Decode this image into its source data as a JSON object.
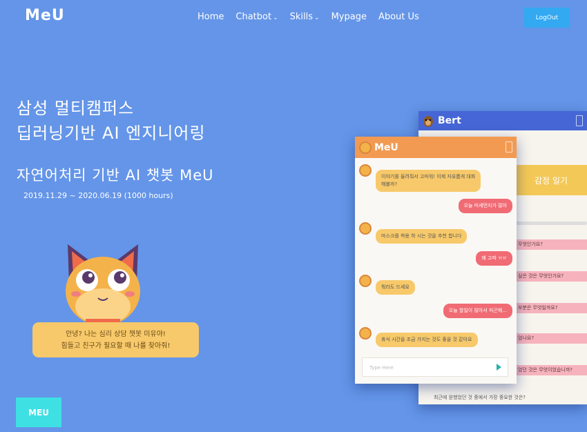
{
  "header": {
    "logo": "MeU",
    "nav": [
      {
        "label": "Home",
        "dropdown": false
      },
      {
        "label": "Chatbot",
        "dropdown": true
      },
      {
        "label": "Skills",
        "dropdown": true
      },
      {
        "label": "Mypage",
        "dropdown": false
      },
      {
        "label": "About Us",
        "dropdown": false
      }
    ],
    "logout_label": "LogOut"
  },
  "hero": {
    "title_line1": "삼성 멀티캠퍼스",
    "title_line2": "딥러닝기반 AI 엔지니어링",
    "subtitle": "자연어처리 기반 AI 챗봇 MeU",
    "date": "2019.11.29 ~ 2020.06.19 (1000 hours)"
  },
  "mascot": {
    "speech_line1": "안녕? 나는 심리 상담 챗봇 미유야!",
    "speech_line2": "힘들고 친구가 필요할 때 나를 찾아줘!"
  },
  "meu_button": "MEU",
  "mockup_back": {
    "title": "Bert",
    "diary_title": "감정 일기",
    "rows": [
      "무엇인가요?",
      "싶은 것은 무엇인가요?",
      "부분은 무엇일까요?",
      "었나요?",
      "었던 것은 무엇이었습니까?"
    ],
    "bottom_text": "최근에 원했었던 것 중에서 가장 중요한 것은?"
  },
  "mockup_front": {
    "title": "MeU",
    "messages": [
      {
        "from": "bot",
        "text_line1": "이야기를 들려줘서 고마워! 이제 자유롭게 대화",
        "text_line2": "해볼까?"
      },
      {
        "from": "user",
        "text_line1": "오늘 미세먼지가 많아"
      },
      {
        "from": "bot",
        "text_line1": "마스크를 착용 하 시는 것을 추천 합니다"
      },
      {
        "from": "user",
        "text_line1": "왜 고파 ㅠㅠ"
      },
      {
        "from": "bot",
        "text_line1": "뭐라도 드세요"
      },
      {
        "from": "user",
        "text_line1": "오늘 할일이 많아서 피곤해..."
      },
      {
        "from": "bot",
        "text_line1": "휴식 시간을 조금 가지는 것도 좋을 것 같아요"
      }
    ],
    "input_placeholder": "Type Here"
  }
}
